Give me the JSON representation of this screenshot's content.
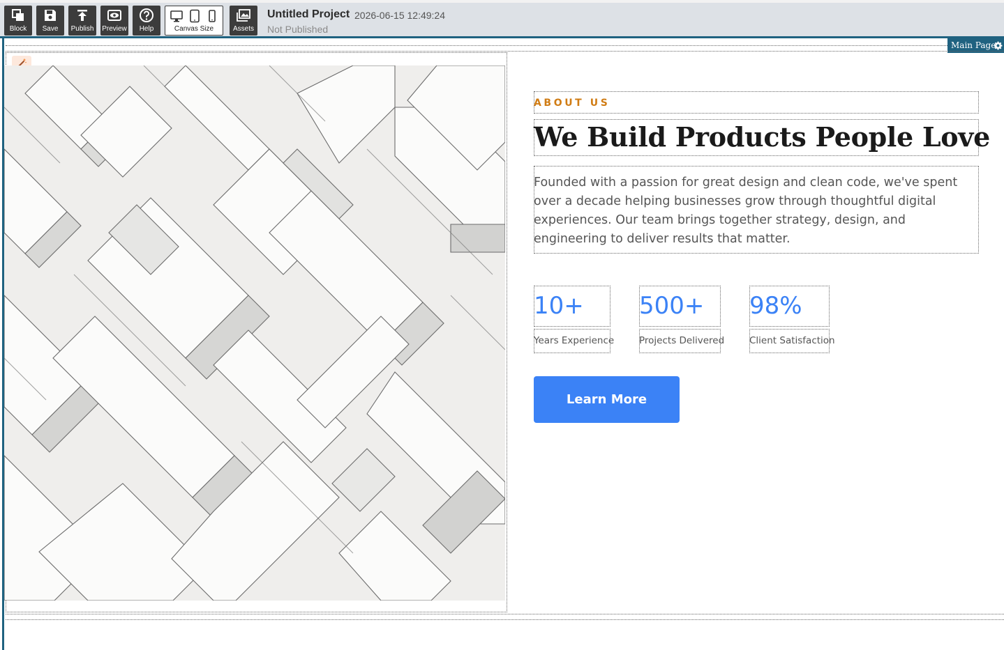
{
  "toolbar": {
    "buttons": [
      {
        "label": "Block",
        "icon": "block-icon"
      },
      {
        "label": "Save",
        "icon": "save-icon"
      },
      {
        "label": "Publish",
        "icon": "publish-icon"
      },
      {
        "label": "Preview",
        "icon": "preview-icon"
      },
      {
        "label": "Help",
        "icon": "help-icon"
      }
    ],
    "canvas_size_label": "Canvas Size",
    "assets_label": "Assets"
  },
  "project": {
    "title": "Untitled Project",
    "date": "2026-06-15 12:49:24",
    "status": "Not Published"
  },
  "canvas": {
    "page_tab": "Main Page"
  },
  "about": {
    "eyebrow": "ABOUT US",
    "headline": "We Build Products People Love",
    "paragraph": "Founded with a passion for great design and clean code, we've spent over a decade helping businesses grow through thoughtful digital experiences. Our team brings together strategy, design, and engineering to deliver results that matter.",
    "stats": [
      {
        "value": "10+",
        "label": "Years Experience"
      },
      {
        "value": "500+",
        "label": "Projects Delivered"
      },
      {
        "value": "98%",
        "label": "Client Satisfaction"
      }
    ],
    "cta_label": "Learn More"
  },
  "colors": {
    "accent_blue": "#3b82f6",
    "eyebrow_orange": "#d07c14",
    "frame_teal": "#1f6280",
    "toolbar_button": "#3c3c3c"
  }
}
